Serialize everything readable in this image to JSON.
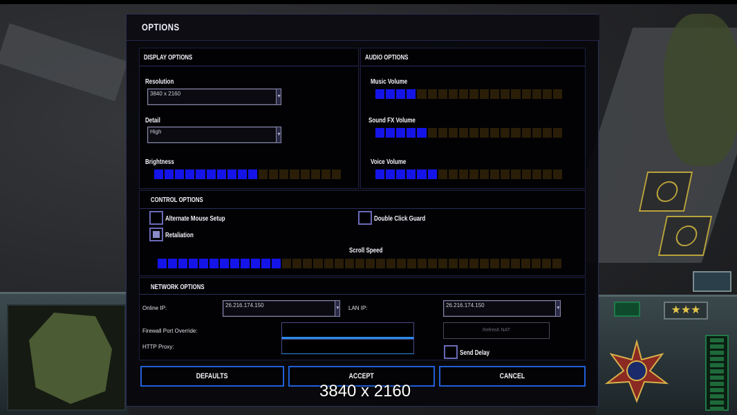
{
  "dialog": {
    "title": "OPTIONS"
  },
  "display": {
    "title": "DISPLAY OPTIONS",
    "resolution_label": "Resolution",
    "resolution_value": "3840 x 2160",
    "detail_label": "Detail",
    "detail_value": "High",
    "brightness_label": "Brightness",
    "brightness_level": {
      "filled": 10,
      "total": 18
    }
  },
  "audio": {
    "title": "AUDIO OPTIONS",
    "music_label": "Music Volume",
    "music_level": {
      "filled": 4,
      "total": 18
    },
    "sfx_label": "Sound FX Volume",
    "sfx_level": {
      "filled": 5,
      "total": 18
    },
    "voice_label": "Voice Volume",
    "voice_level": {
      "filled": 6,
      "total": 18
    }
  },
  "control": {
    "title": "CONTROL OPTIONS",
    "alt_mouse_label": "Alternate Mouse Setup",
    "alt_mouse_checked": false,
    "retaliation_label": "Retaliation",
    "retaliation_checked": true,
    "double_click_label": "Double Click Guard",
    "double_click_checked": false,
    "scroll_speed_label": "Scroll Speed",
    "scroll_speed_level": {
      "filled": 12,
      "total": 39
    }
  },
  "network": {
    "title": "NETWORK OPTIONS",
    "online_ip_label": "Online IP:",
    "online_ip_value": "26.216.174.150",
    "lan_ip_label": "LAN IP:",
    "lan_ip_value": "26.216.174.150",
    "firewall_label": "Firewall Port Override:",
    "http_proxy_label": "HTTP Proxy:",
    "refresh_nat_label": "Refresh NAT",
    "send_delay_label": "Send Delay",
    "send_delay_checked": false
  },
  "buttons": {
    "defaults": "DEFAULTS",
    "accept": "ACCEPT",
    "cancel": "CANCEL"
  },
  "overlay": {
    "resolution_text": "3840 x 2160"
  },
  "icons": {
    "dropdown": "triangle-down-icon",
    "ranks": "★★★"
  },
  "colors": {
    "slider_on": "#1414e8",
    "slider_off": "#2a1e08",
    "button_border": "#2060d8",
    "field_focus": "#2a8ae8"
  }
}
